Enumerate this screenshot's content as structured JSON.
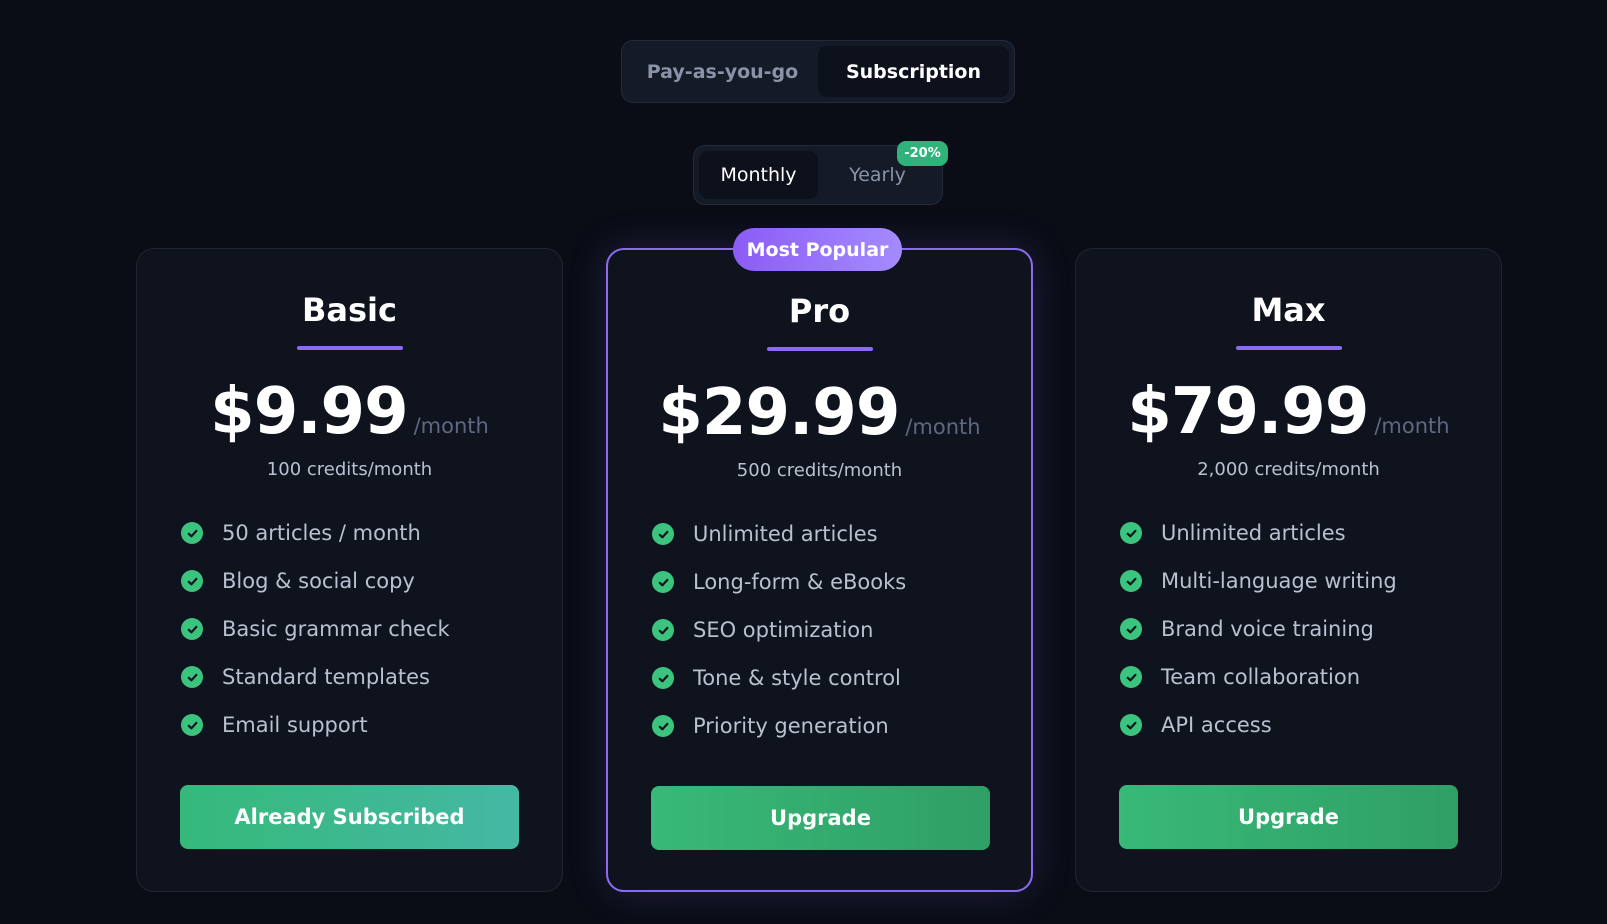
{
  "mode_toggle": {
    "options": [
      "Pay-as-you-go",
      "Subscription"
    ],
    "active": "Subscription"
  },
  "billing_toggle": {
    "options": [
      "Monthly",
      "Yearly"
    ],
    "active": "Monthly",
    "yearly_discount": "-20%"
  },
  "colors": {
    "background": "#0a0d16",
    "accent_purple": "#8b6cf0",
    "accent_green": "#3cc47f"
  },
  "plans": [
    {
      "name": "Basic",
      "price": "$9.99",
      "period": "/month",
      "credits": "100 credits/month",
      "features": [
        "50 articles / month",
        "Blog & social copy",
        "Basic grammar check",
        "Standard templates",
        "Email support"
      ],
      "cta": "Already Subscribed",
      "featured": false
    },
    {
      "name": "Pro",
      "badge": "Most Popular",
      "price": "$29.99",
      "period": "/month",
      "credits": "500 credits/month",
      "features": [
        "Unlimited articles",
        "Long-form & eBooks",
        "SEO optimization",
        "Tone & style control",
        "Priority generation"
      ],
      "cta": "Upgrade",
      "featured": true
    },
    {
      "name": "Max",
      "price": "$79.99",
      "period": "/month",
      "credits": "2,000 credits/month",
      "features": [
        "Unlimited articles",
        "Multi-language writing",
        "Brand voice training",
        "Team collaboration",
        "API access"
      ],
      "cta": "Upgrade",
      "featured": false
    }
  ]
}
